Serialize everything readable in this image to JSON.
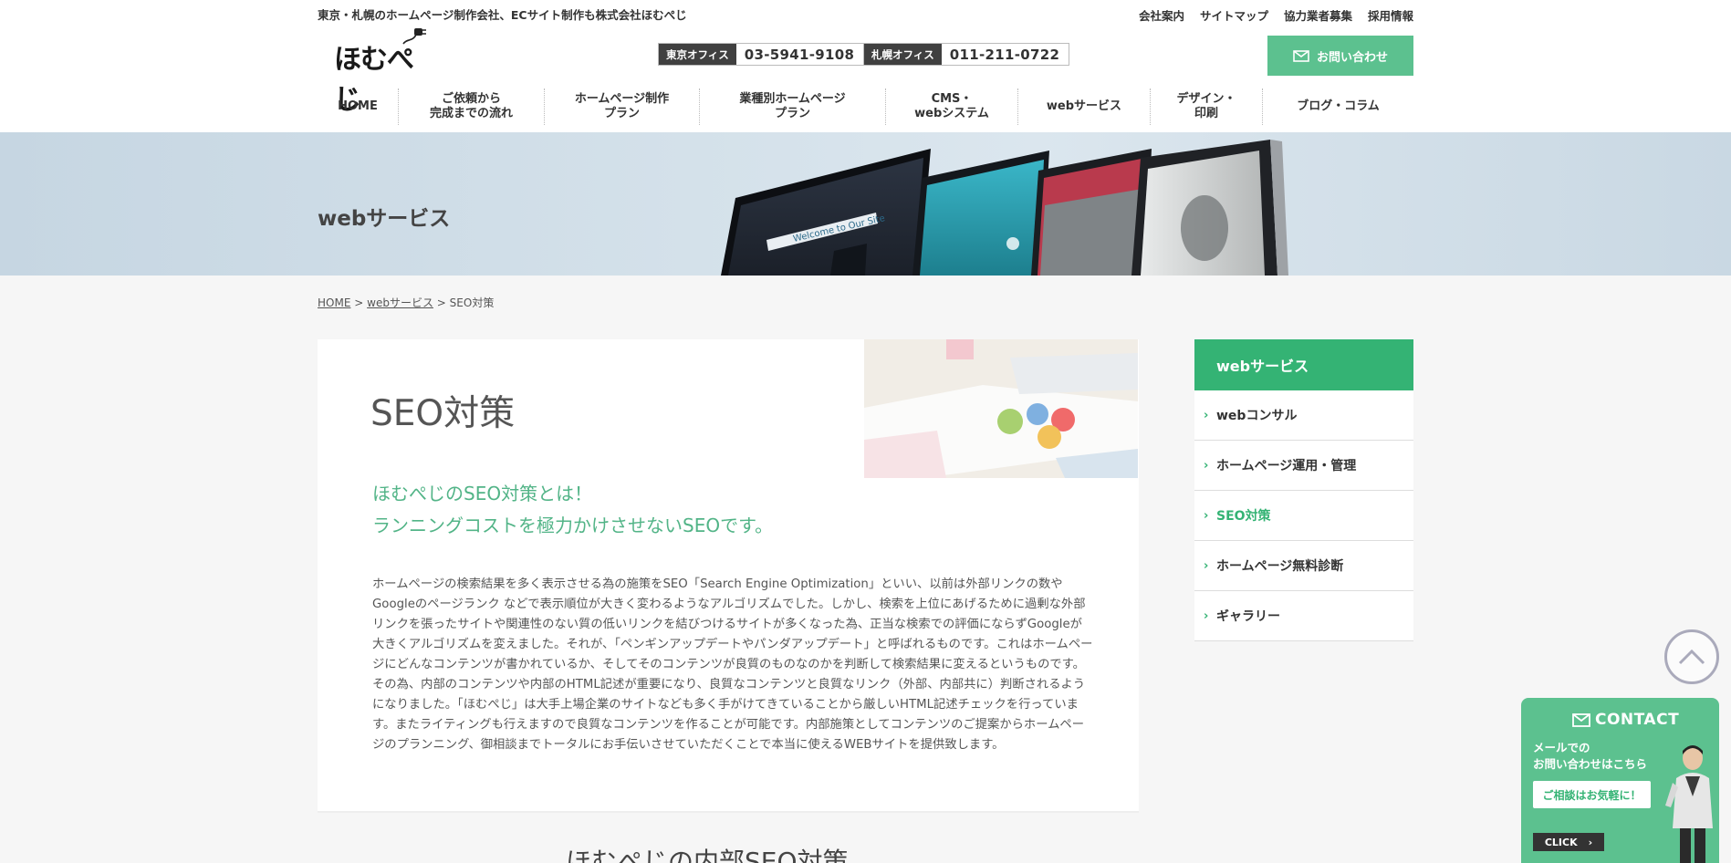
{
  "header": {
    "tagline": "東京・札幌のホームページ制作会社、ECサイト制作も株式会社ほむぺじ",
    "top_links": [
      "会社案内",
      "サイトマップ",
      "協力業者募集",
      "採用情報"
    ],
    "logo_text": "ほむぺじ",
    "offices": [
      {
        "label": "東京オフィス",
        "phone": "03-5941-9108"
      },
      {
        "label": "札幌オフィス",
        "phone": "011-211-0722"
      }
    ],
    "contact_button": "お問い合わせ",
    "nav": [
      {
        "line1": "HOME",
        "line2": ""
      },
      {
        "line1": "ご依頼から",
        "line2": "完成までの流れ"
      },
      {
        "line1": "ホームページ制作",
        "line2": "プラン"
      },
      {
        "line1": "業種別ホームページ",
        "line2": "プラン"
      },
      {
        "line1": "CMS・",
        "line2": "webシステム"
      },
      {
        "line1": "webサービス",
        "line2": ""
      },
      {
        "line1": "デザイン・",
        "line2": "印刷"
      },
      {
        "line1": "ブログ・コラム",
        "line2": ""
      }
    ]
  },
  "hero": {
    "title": "webサービス",
    "screen_text": "Welcome to Our Site"
  },
  "breadcrumb": {
    "home": "HOME",
    "sep": ">",
    "parent": "webサービス",
    "current": "SEO対策"
  },
  "main": {
    "title": "SEO対策",
    "lead_line1": "ほむぺじのSEO対策とは！",
    "lead_line2": "ランニングコストを極力かけさせないSEOです。",
    "body": "ホームページの検索結果を多く表示させる為の施策をSEO「Search Engine Optimization」といい、以前は外部リンクの数やGoogleのページランク などで表示順位が大きく変わるようなアルゴリズムでした。しかし、検索を上位にあげるために過剰な外部リンクを張ったサイトや関連性のない質の低いリンクを結びつけるサイトが多くなった為、正当な検索での評価にならずGoogleが大きくアルゴリズムを変えました。それが、「ペンギンアップデートやパンダアップデート」と呼ばれるものです。これはホームページにどんなコンテンツが書かれているか、そしてそのコンテンツが良質のものなのかを判断して検索結果に変えるというものです。その為、内部のコンテンツや内部のHTML記述が重要になり、良質なコンテンツと良質なリンク（外部、内部共に）判断されるようになりました。「ほむぺじ」は大手上場企業のサイトなども多く手がけてきていることから厳しいHTML記述チェックを行っています。またライティングも行えますので良質なコンテンツを作ることが可能です。内部施策としてコンテンツのご提案からホームページのプランニング、御相談までトータルにお手伝いさせていただくことで本当に使えるWEBサイトを提供致します。",
    "next_heading": "ほむぺじの内部SEO対策"
  },
  "sidebar": {
    "heading": "webサービス",
    "items": [
      {
        "label": "webコンサル",
        "active": false
      },
      {
        "label": "ホームページ運用・管理",
        "active": false
      },
      {
        "label": "SEO対策",
        "active": true
      },
      {
        "label": "ホームページ無料診断",
        "active": false
      },
      {
        "label": "ギャラリー",
        "active": false
      }
    ]
  },
  "cta": {
    "title": "CONTACT",
    "sub_line1": "メールでの",
    "sub_line2": "お問い合わせはこちら",
    "bubble": "ご相談はお気軽に！",
    "click": "CLICK"
  },
  "colors": {
    "accent_green": "#34b374",
    "light_green": "#5cc18f",
    "lead_green": "#52b487"
  }
}
